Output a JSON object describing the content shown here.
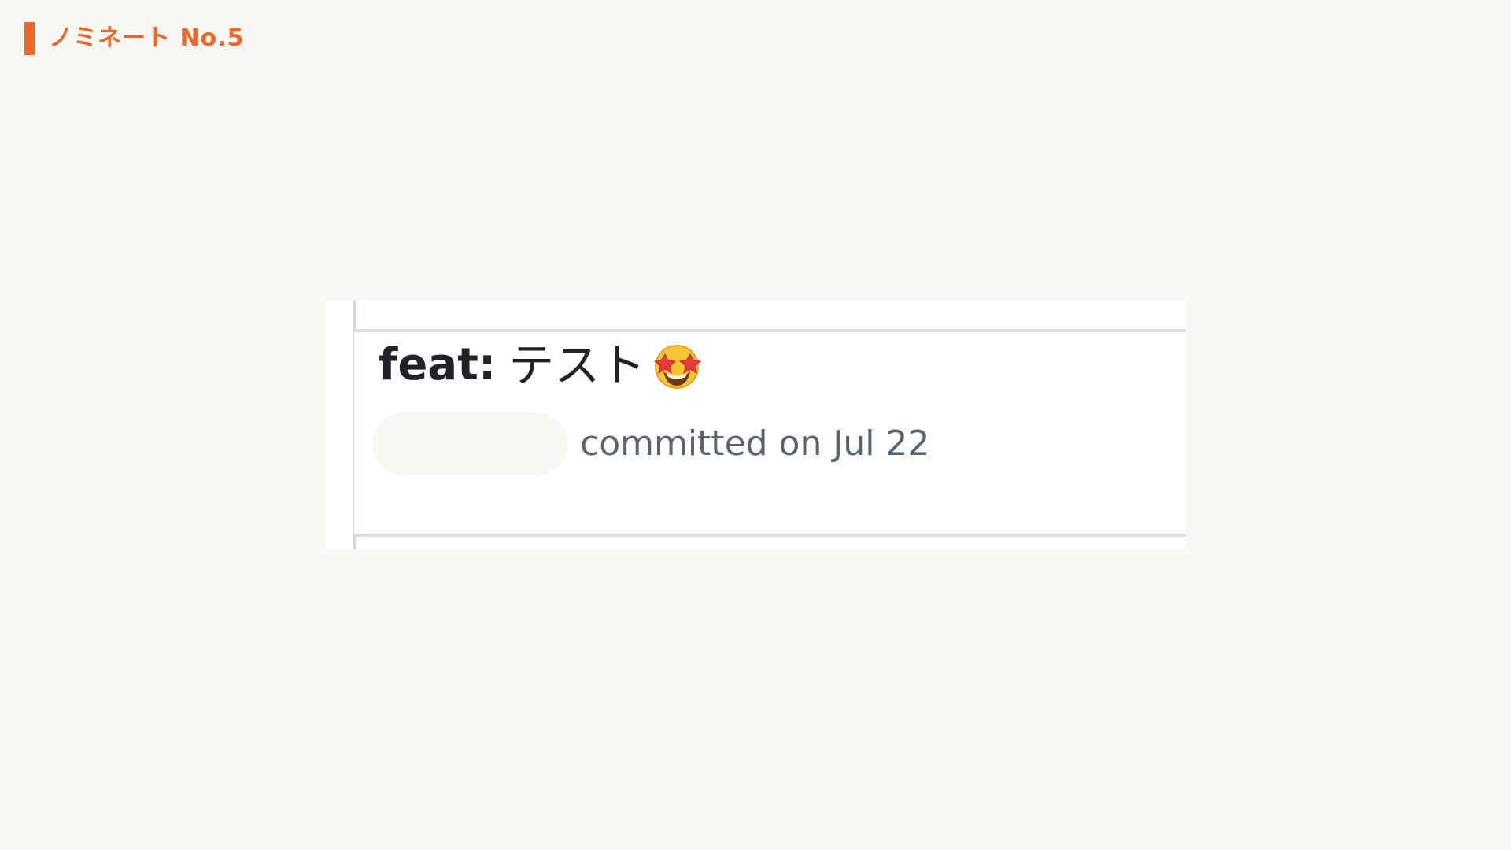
{
  "header": {
    "title": "ノミネート No.5",
    "accent_color": "#f26522"
  },
  "commit": {
    "prefix": "feat:",
    "message": "テスト",
    "emoji_icon": "star-struck-emoji-icon",
    "status_text": "committed on Jul 22"
  },
  "colors": {
    "background": "#f8f7f4",
    "card": "#ffffff",
    "border": "#d8dee4",
    "title_text": "#1f2328",
    "meta_text": "#59636e"
  }
}
